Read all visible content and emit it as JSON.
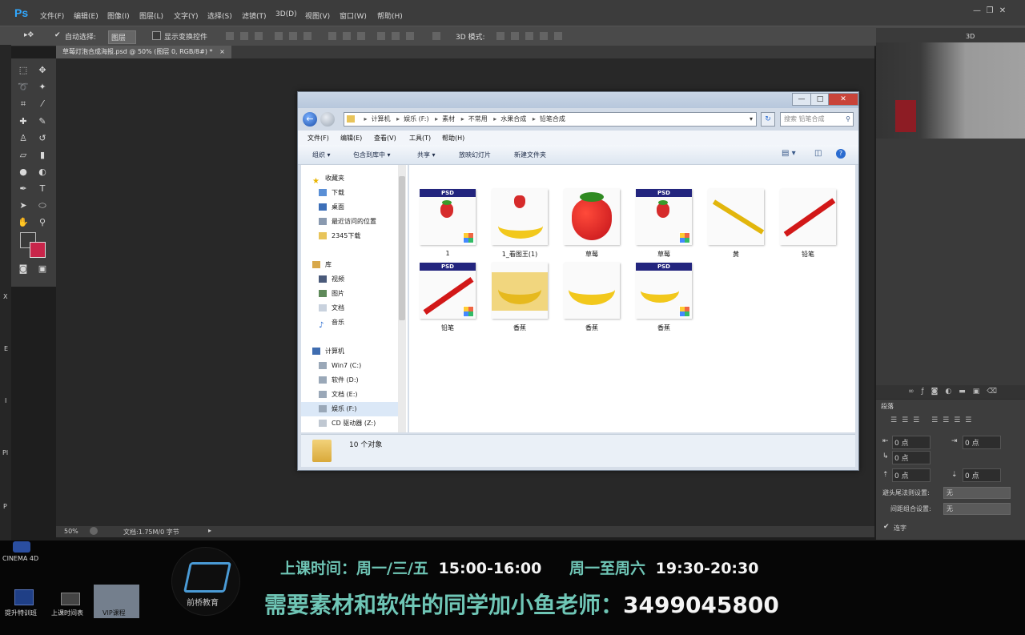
{
  "photoshop": {
    "logo": "Ps",
    "menu": [
      "文件(F)",
      "编辑(E)",
      "图像(I)",
      "图层(L)",
      "文字(Y)",
      "选择(S)",
      "滤镜(T)",
      "3D(D)",
      "视图(V)",
      "窗口(W)",
      "帮助(H)"
    ],
    "options": {
      "auto_select_label": "自动选择:",
      "auto_select_value": "图层",
      "show_transform_label": "显示变换控件",
      "mode3d_label": "3D 模式:"
    },
    "doc_tab": "草莓灯泡合成海报.psd @ 50% (图层 0, RGB/8#) *",
    "tab_close": "×",
    "status": {
      "zoom": "50%",
      "doc": "文档:1.75M/0 字节"
    },
    "panel_top_label": "3D",
    "paragraph_panel": {
      "title": "段落",
      "indent_values": [
        "0 点",
        "0 点",
        "0 点",
        "0 点",
        "0 点"
      ],
      "kinsoku_label": "避头尾法则设置:",
      "kinsoku_value": "无",
      "mojikumi_label": "间距组合设置:",
      "mojikumi_value": "无",
      "hyphen_label": "连字"
    },
    "left_strip_letters": [
      "X",
      "E",
      "I",
      "Pl",
      "P"
    ]
  },
  "explorer": {
    "controls": {
      "min": "—",
      "max": "□",
      "close": "✕"
    },
    "breadcrumb": [
      "计算机",
      "娱乐 (F:)",
      "素材",
      "不常用",
      "水果合成",
      "铅笔合成"
    ],
    "search_placeholder": "搜索 铅笔合成",
    "menu": [
      "文件(F)",
      "编辑(E)",
      "查看(V)",
      "工具(T)",
      "帮助(H)"
    ],
    "commands": [
      "组织 ▾",
      "包含到库中 ▾",
      "共享 ▾",
      "放映幻灯片",
      "新建文件夹"
    ],
    "nav": {
      "favorites_title": "收藏夹",
      "favorites": [
        "下载",
        "桌面",
        "最近访问的位置",
        "2345下载"
      ],
      "libraries_title": "库",
      "libraries": [
        "视频",
        "图片",
        "文档",
        "音乐"
      ],
      "computer_title": "计算机",
      "drives": [
        "Win7 (C:)",
        "软件 (D:)",
        "文档 (E:)",
        "娱乐 (F:)",
        "CD 驱动器 (Z:)"
      ]
    },
    "psd_label": "PSD",
    "files": [
      {
        "name": "1",
        "kind": "psd-strawberry"
      },
      {
        "name": "1_看图王(1)",
        "kind": "strawberry-banana"
      },
      {
        "name": "草莓",
        "kind": "strawberry"
      },
      {
        "name": "草莓",
        "kind": "psd-strawberry"
      },
      {
        "name": "黄",
        "kind": "pencil-yellow"
      },
      {
        "name": "铅笔",
        "kind": "pencil-red"
      },
      {
        "name": "铅笔",
        "kind": "psd-pencil"
      },
      {
        "name": "香蕉",
        "kind": "banana-bg"
      },
      {
        "name": "香蕉",
        "kind": "banana"
      },
      {
        "name": "香蕉",
        "kind": "psd-banana"
      }
    ],
    "count_text": "10 个对象"
  },
  "taskbar": {
    "items": [
      "CINEMA 4D",
      "提升特训班",
      "上课时间表",
      "VIP课程"
    ]
  },
  "banner": {
    "logo_text": "前桥教育",
    "schedule_label": "上课时间：周一/三/五",
    "schedule_time1": "15:00-16:00",
    "schedule_label2": "周一至周六",
    "schedule_time2": "19:30-20:30",
    "contact_label": "需要素材和软件的同学加小鱼老师：",
    "contact_number": "3499045800"
  },
  "colors": {
    "fg_swatch": "#3a3a3a",
    "bg_swatch": "#c8254a",
    "banner_text": "#6fc6b6"
  }
}
